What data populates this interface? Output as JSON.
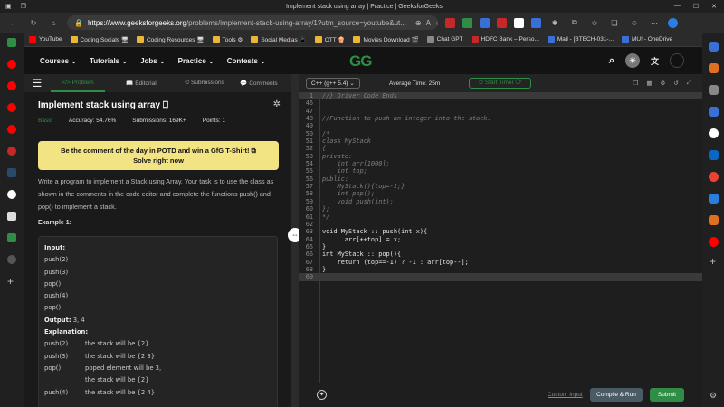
{
  "browser": {
    "tab_title": "Implement stack using array | Practice | GeeksforGeeks",
    "url_host": "https://www.geeksforgeeks.org",
    "url_path": "/problems/implement-stack-using-array/1?utm_source=youtube&ut...",
    "window_controls": [
      "—",
      "☐",
      "✕"
    ]
  },
  "bookmarks": [
    {
      "label": "YouTube",
      "color": "#ff0000"
    },
    {
      "label": "Coding Socials 🖥",
      "color": "#e8b73a"
    },
    {
      "label": "Coding Resources 🖥",
      "color": "#e8b73a"
    },
    {
      "label": "Tools ⚙",
      "color": "#e8b73a"
    },
    {
      "label": "Social Medias 📱",
      "color": "#e8b73a"
    },
    {
      "label": "OTT 🍿",
      "color": "#e8b73a"
    },
    {
      "label": "Movies Download 🎬",
      "color": "#e8b73a"
    },
    {
      "label": "Chat GPT",
      "color": "#888888"
    },
    {
      "label": "HDFC Bank – Perso...",
      "color": "#c62828"
    },
    {
      "label": "Mail - [BTECH-031-...",
      "color": "#3b6fd8"
    },
    {
      "label": "MU! - OneDrive",
      "color": "#3b6fd8"
    }
  ],
  "nav": {
    "menu": [
      "Courses ⌄",
      "Tutorials ⌄",
      "Jobs ⌄",
      "Practice ⌄",
      "Contests ⌄"
    ],
    "logo": "GG"
  },
  "tabs": [
    "</> Problem",
    "📖 Editorial",
    "⏱ Submissions",
    "💬 Comments"
  ],
  "problem": {
    "title": "Implement stack using array",
    "difficulty": "Basic",
    "accuracy": "Accuracy: 54.76%",
    "submissions": "Submissions: 169K+",
    "points": "Points: 1",
    "banner_line1": "Be the comment of the day in POTD and win a GfG T-Shirt!",
    "banner_line2": "Solve right now",
    "description": "Write a program to implement a Stack using Array. Your task is to use the class as shown in the comments in the code editor and complete the functions push() and pop() to implement a stack.",
    "example_label": "Example 1:",
    "example": {
      "input_label": "Input:",
      "input_lines": [
        "push(2)",
        "push(3)",
        "pop()",
        "push(4)",
        "pop()"
      ],
      "output_label": "Output:",
      "output_value": "3, 4",
      "explanation_label": "Explanation:",
      "explanation": [
        {
          "op": "push(2)",
          "text": "the stack will be {2}"
        },
        {
          "op": "push(3)",
          "text": "the stack will be {2 3}"
        },
        {
          "op": "pop()",
          "text": "poped element will be 3,"
        },
        {
          "op": "",
          "text": "the stack will be {2}"
        },
        {
          "op": "push(4)",
          "text": "the stack will be {2 4}"
        }
      ]
    }
  },
  "editor": {
    "language": "C++ (g++ 5.4) ⌄",
    "average_time": "Average Time: 25m",
    "start_timer": "⏱ Start Timer ⟳",
    "lines": [
      {
        "n": "1",
        "t": "//} Driver Code Ends",
        "cm": true,
        "hl": true
      },
      {
        "n": "46",
        "t": ""
      },
      {
        "n": "47",
        "t": ""
      },
      {
        "n": "48",
        "t": "//Function to push an integer into the stack.",
        "cm": true
      },
      {
        "n": "49",
        "t": ""
      },
      {
        "n": "50",
        "t": "/*",
        "cm": true
      },
      {
        "n": "51",
        "t": "class MyStack",
        "cm": true
      },
      {
        "n": "52",
        "t": "{",
        "cm": true
      },
      {
        "n": "53",
        "t": "private:",
        "cm": true
      },
      {
        "n": "54",
        "t": "    int arr[1000];",
        "cm": true
      },
      {
        "n": "55",
        "t": "    int top;",
        "cm": true
      },
      {
        "n": "56",
        "t": "public:",
        "cm": true
      },
      {
        "n": "57",
        "t": "    MyStack(){top=-1;}",
        "cm": true
      },
      {
        "n": "58",
        "t": "    int pop();",
        "cm": true
      },
      {
        "n": "59",
        "t": "    void push(int);",
        "cm": true
      },
      {
        "n": "60",
        "t": "};",
        "cm": true
      },
      {
        "n": "61",
        "t": "*/",
        "cm": true
      },
      {
        "n": "62",
        "t": ""
      },
      {
        "n": "63",
        "t": "void MyStack :: push(int x){"
      },
      {
        "n": "64",
        "t": "      arr[++top] = x;"
      },
      {
        "n": "65",
        "t": "}"
      },
      {
        "n": "66",
        "t": "int MyStack :: pop(){"
      },
      {
        "n": "67",
        "t": "    return (top==-1) ? -1 : arr[top--];"
      },
      {
        "n": "68",
        "t": "}"
      },
      {
        "n": "69",
        "t": "",
        "hl": true
      }
    ],
    "custom_input": "Custom Input",
    "compile_run": "Compile & Run",
    "submit": "Submit"
  },
  "colors": {
    "accent": "#2f8d46",
    "banner": "#f3e483"
  }
}
